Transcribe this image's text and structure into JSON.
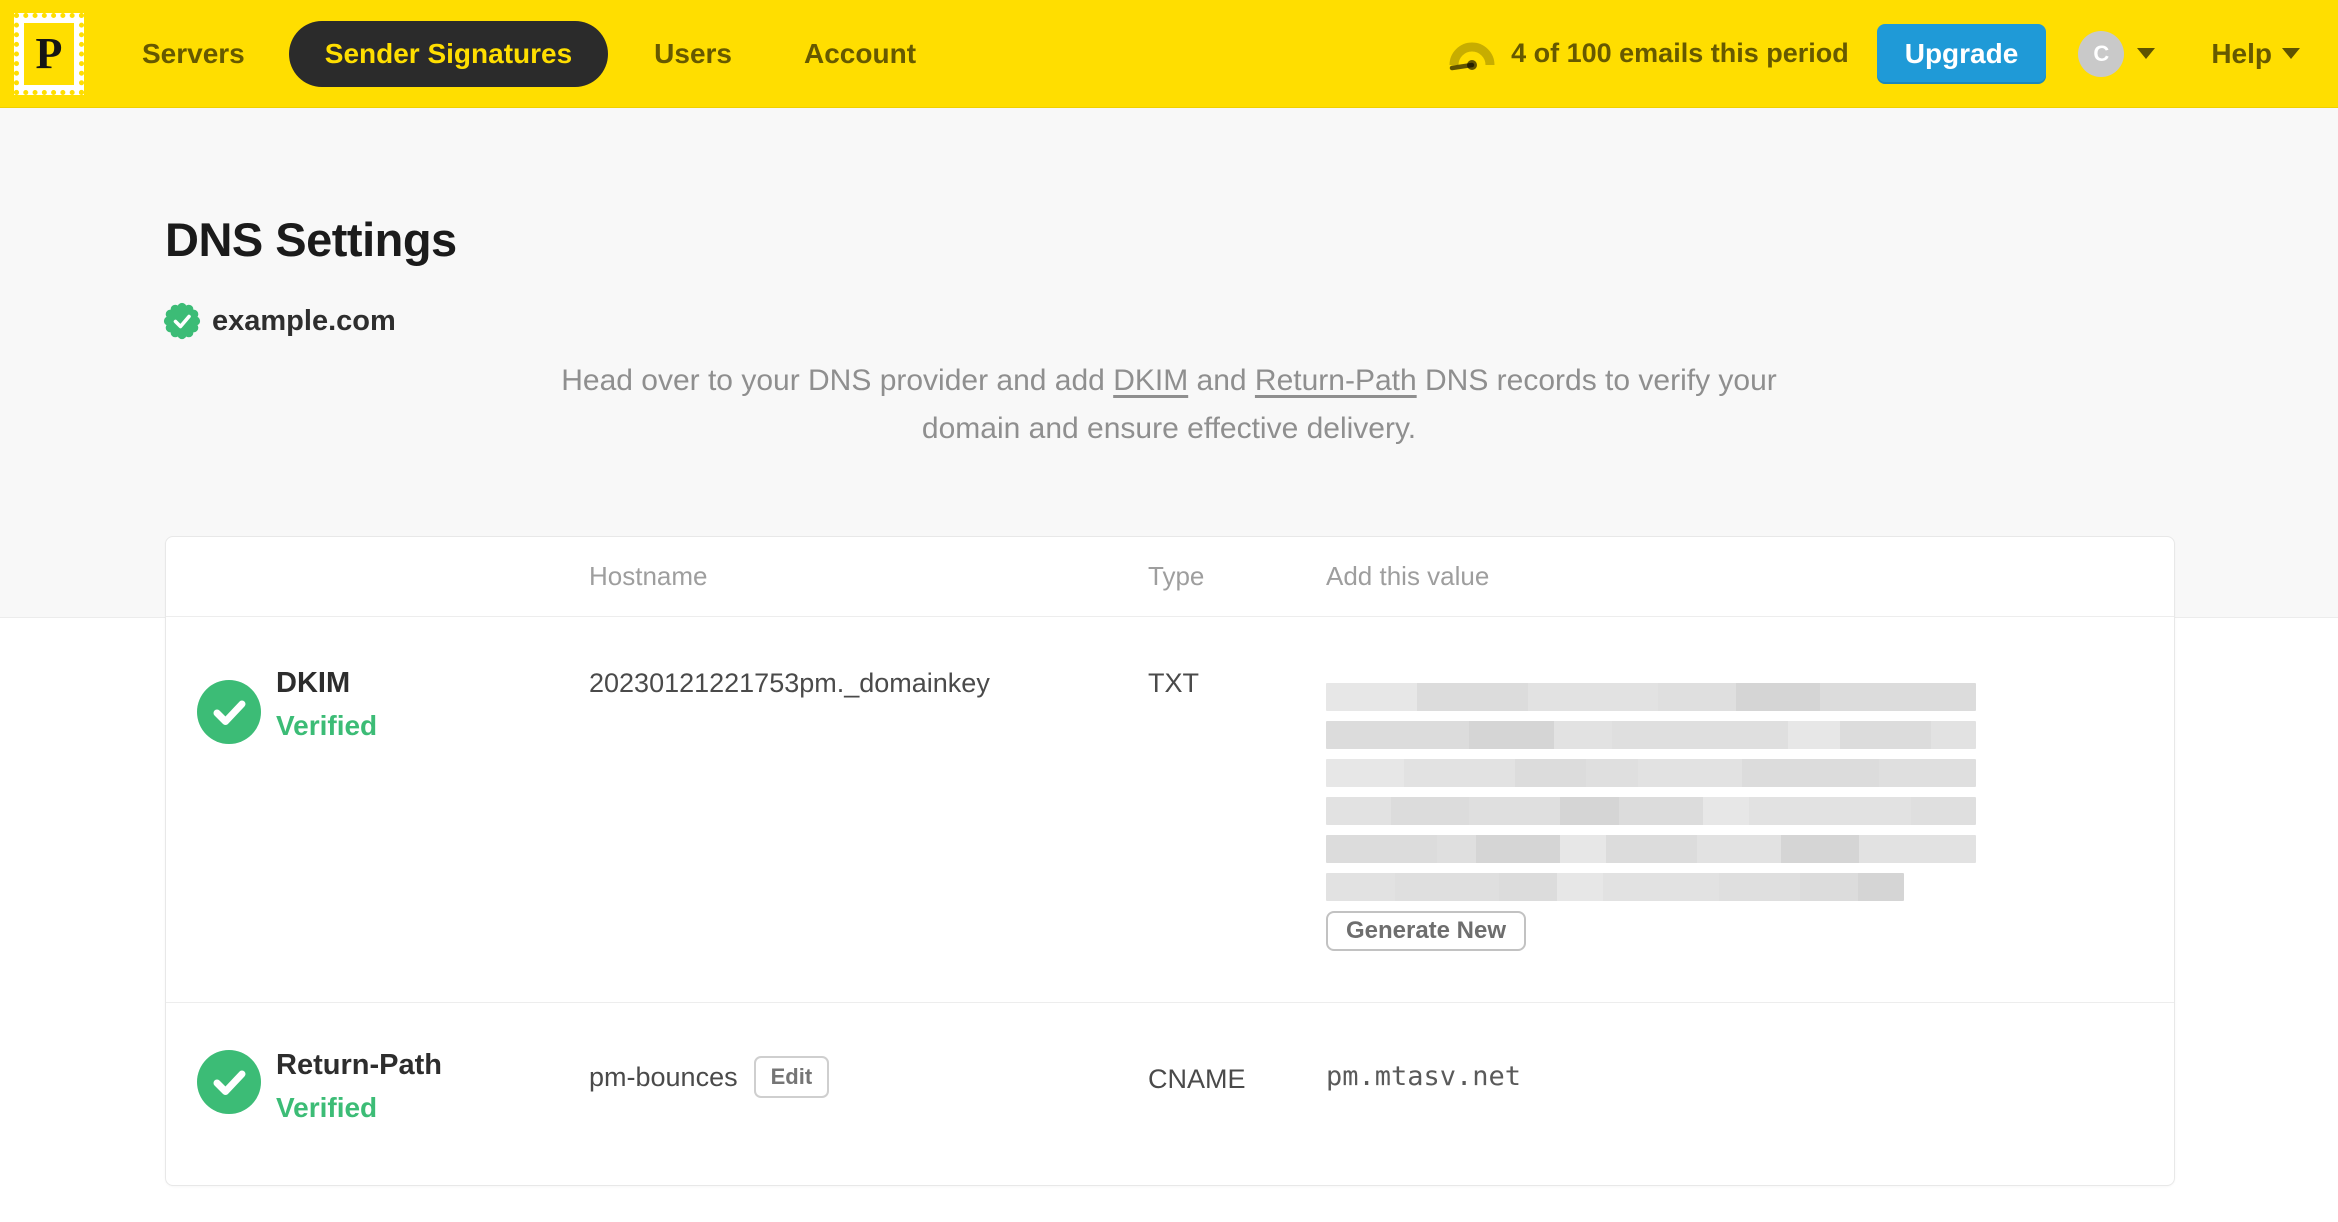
{
  "colors": {
    "brand_yellow": "#FFDE00",
    "accent_blue": "#1F9AD7",
    "success_green": "#3CBC76",
    "active_pill": "#2b2b2b"
  },
  "topnav": {
    "logo_letter": "P",
    "items": [
      {
        "label": "Servers",
        "active": false
      },
      {
        "label": "Sender Signatures",
        "active": true
      },
      {
        "label": "Users",
        "active": false
      },
      {
        "label": "Account",
        "active": false
      }
    ],
    "usage_text": "4 of 100 emails this period",
    "upgrade_label": "Upgrade",
    "avatar_initial": "C",
    "help_label": "Help"
  },
  "page": {
    "title": "DNS Settings",
    "domain": "example.com",
    "domain_verified": true,
    "description": {
      "pre": "Head over to your DNS provider and add ",
      "link1": "DKIM",
      "mid": " and ",
      "link2": "Return-Path",
      "post": " DNS records to verify your domain and ensure effective delivery."
    }
  },
  "table": {
    "headers": {
      "hostname": "Hostname",
      "type": "Type",
      "value": "Add this value"
    },
    "rows": [
      {
        "name": "DKIM",
        "status": "Verified",
        "hostname": "20230121221753pm._domainkey",
        "type": "TXT",
        "value_redacted": true,
        "action_label": "Generate New"
      },
      {
        "name": "Return-Path",
        "status": "Verified",
        "hostname": "pm-bounces",
        "edit_label": "Edit",
        "type": "CNAME",
        "value": "pm.mtasv.net"
      }
    ]
  }
}
